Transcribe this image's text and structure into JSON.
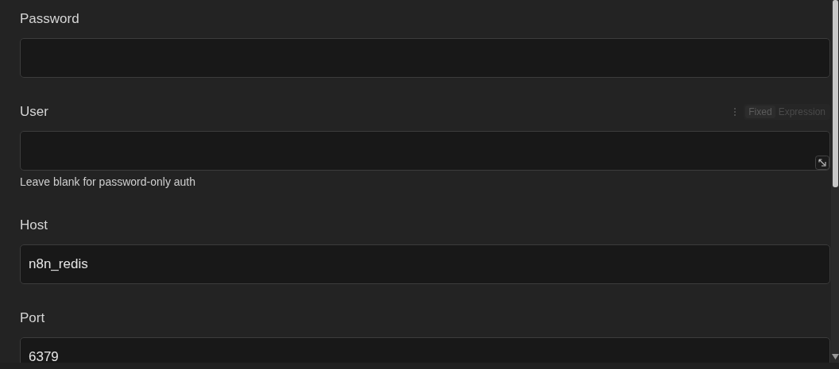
{
  "fields": [
    {
      "label": "Password"
    },
    {
      "label": "User",
      "mode_options": [
        {
          "label": "Fixed",
          "selected": true
        },
        {
          "label": "Expression",
          "selected": false
        }
      ],
      "expandable": true,
      "hint": "Leave blank for password-only auth"
    },
    {
      "label": "Host",
      "value": "n8n_redis"
    },
    {
      "label": "Port",
      "value": "6379"
    }
  ]
}
